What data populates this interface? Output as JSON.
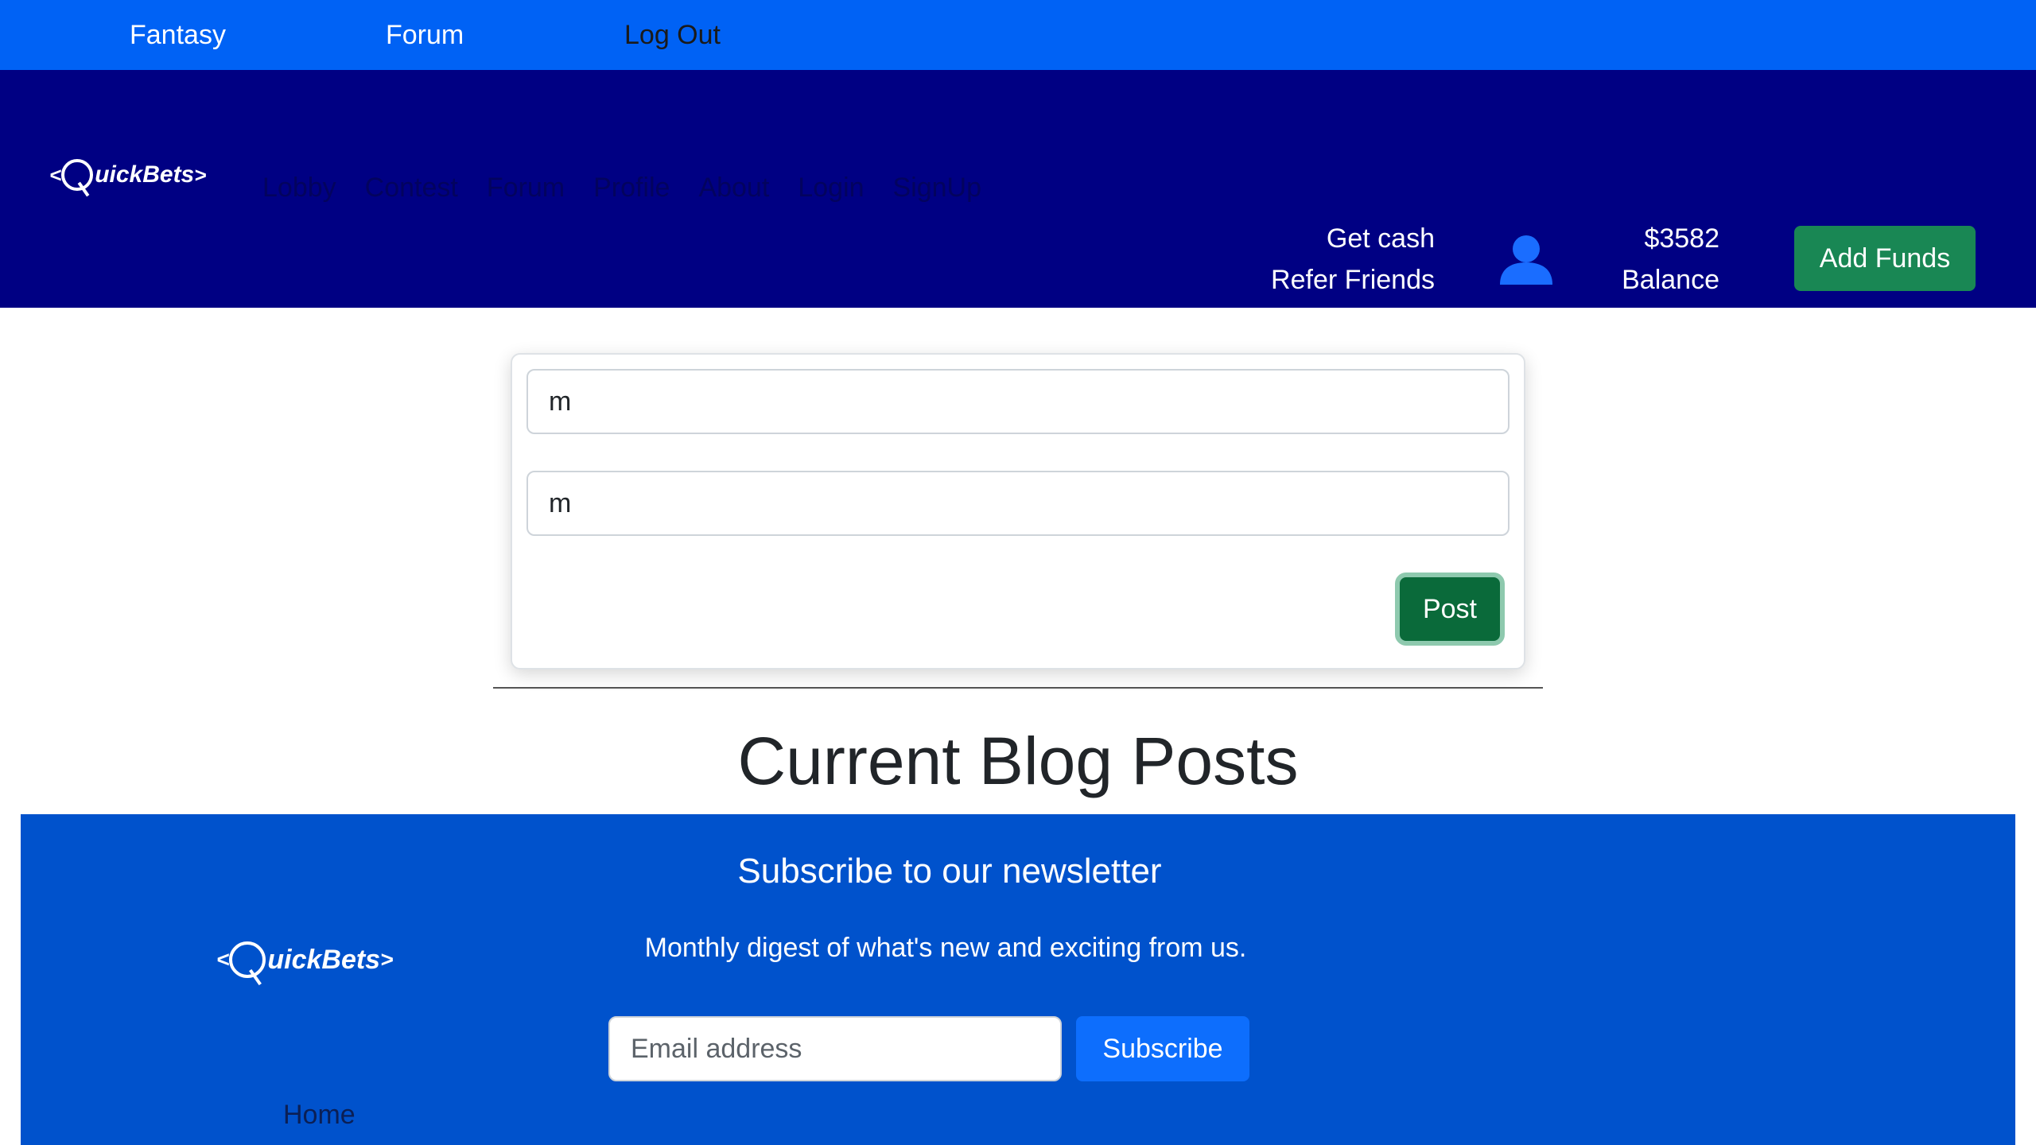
{
  "topbar": {
    "links": [
      "Fantasy",
      "Forum",
      "Log Out"
    ]
  },
  "brand": {
    "prefix": "<",
    "letter": "Q",
    "name": "uickBets",
    "suffix": ">"
  },
  "navbar": {
    "links": [
      "Lobby",
      "Contest",
      "Forum",
      "Profile",
      "About",
      "Login",
      "SignUp"
    ],
    "refer_line1": "Get cash",
    "refer_line2": "Refer Friends",
    "user_icon": "user-icon",
    "balance_amount": "$3582",
    "balance_label": "Balance",
    "add_funds_label": "Add Funds"
  },
  "post_form": {
    "title_value": "m",
    "body_value": "m",
    "post_label": "Post"
  },
  "page": {
    "title": "Current Blog Posts"
  },
  "footer": {
    "newsletter_title": "Subscribe to our newsletter",
    "newsletter_desc": "Monthly digest of what's new and exciting from us.",
    "email_placeholder": "Email address",
    "subscribe_label": "Subscribe",
    "home_link": "Home"
  },
  "colors": {
    "topbar": "#0062f5",
    "navbar": "#000083",
    "footer": "#0052cc",
    "success": "#198754",
    "primary": "#0d6efd"
  }
}
